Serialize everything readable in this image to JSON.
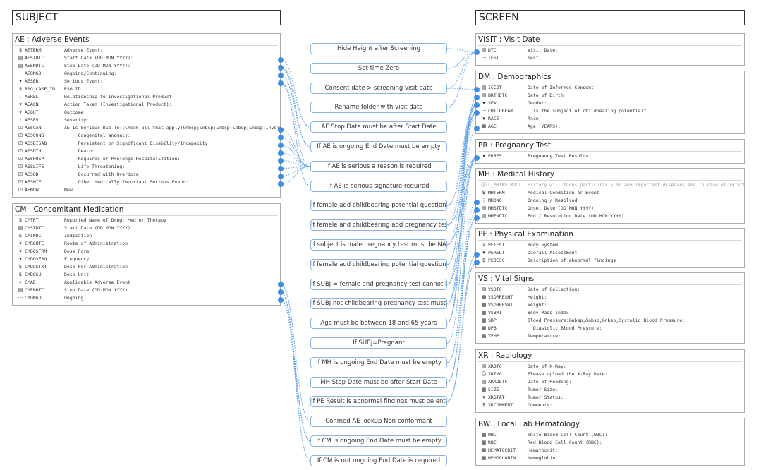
{
  "headers": {
    "subject": "SUBJECT",
    "screen": "SCREEN"
  },
  "colors": {
    "link": "#5a9de8",
    "dot": "#3f8ee6",
    "rule_border": "#8bb4e0"
  },
  "icon_legend": {
    "text": "dollar-sign-icon",
    "date": "calendar-icon",
    "ellipsis": "ellipsis-icon",
    "dropdown": "caret-down-icon",
    "vertical": "vertical-dots-icon",
    "checkbox": "checked-box-icon",
    "search": "search-icon",
    "calc": "calculator-icon",
    "info": "info-icon",
    "user": "user-icon"
  },
  "subject_forms": [
    {
      "title": "AE : Adverse Events",
      "fields": [
        {
          "icon": "text",
          "code": "AETERM",
          "label": "Adverse Event:"
        },
        {
          "icon": "date",
          "code": "AESTDTC",
          "label": "Start Date (DD MON YYYY):"
        },
        {
          "icon": "date",
          "code": "AEENDTC",
          "label": "Stop Date (DD MON YYYY):"
        },
        {
          "icon": "ellipsis",
          "code": "AEONGO",
          "label": "Ongoing/Continuing:"
        },
        {
          "icon": "dropdown",
          "code": "AESER",
          "label": "Serious Event:"
        },
        {
          "icon": "text",
          "code": "RSG_CASE_ID",
          "label": "RSG ID"
        },
        {
          "icon": "vertical",
          "code": "AEREL",
          "label": "Relationship to Investigational Product:"
        },
        {
          "icon": "dropdown",
          "code": "AEACN",
          "label": "Action Taken (Investigational Product):"
        },
        {
          "icon": "dropdown",
          "code": "AEOUT",
          "label": "Outcome:"
        },
        {
          "icon": "vertical",
          "code": "AESEV",
          "label": "Severity:"
        },
        {
          "icon": "checkbox",
          "code": "AESCAN",
          "label": "AE Is Serious Due To:(Check all that apply)&nbsp;&nbsp;&nbsp;&nbsp;&nbsp;Involve"
        },
        {
          "icon": "checkbox",
          "code": "AESCONG",
          "label": "     Congenital anomaly:"
        },
        {
          "icon": "checkbox",
          "code": "AESDISAB",
          "label": "     Persistent or Significant Disability/Incapacity:"
        },
        {
          "icon": "checkbox",
          "code": "AESDTH",
          "label": "     Death:"
        },
        {
          "icon": "checkbox",
          "code": "AESHOSP",
          "label": "     Requires or Prolongs Hospitalization:"
        },
        {
          "icon": "checkbox",
          "code": "AESLIFE",
          "label": "     Life Threatening:"
        },
        {
          "icon": "checkbox",
          "code": "AESOD",
          "label": "     Occurred with Overdose:"
        },
        {
          "icon": "checkbox",
          "code": "AESMIE",
          "label": "     Other Medically Important Serious Event:"
        },
        {
          "icon": "checkbox",
          "code": "AENOW",
          "label": "Now"
        }
      ]
    },
    {
      "title": "CM : Concomitant Medication",
      "fields": [
        {
          "icon": "text",
          "code": "CMTRT",
          "label": "Reported Name of Drug, Med or Therapy"
        },
        {
          "icon": "date",
          "code": "CMSTDTC",
          "label": "Start Date (DD MON YYYY)"
        },
        {
          "icon": "text",
          "code": "CMINDC",
          "label": "Indication"
        },
        {
          "icon": "dropdown",
          "code": "CMROUTE",
          "label": "Route of Administration"
        },
        {
          "icon": "dropdown",
          "code": "CMDOSFRM",
          "label": "Dose Form"
        },
        {
          "icon": "dropdown",
          "code": "CMDOSFRQ",
          "label": "Frequency"
        },
        {
          "icon": "text",
          "code": "CMDOSTXT",
          "label": "Dose Per Administration"
        },
        {
          "icon": "text",
          "code": "CMDOSU",
          "label": "Dose Unit"
        },
        {
          "icon": "search",
          "code": "CMAE",
          "label": "Applicable Adverse Event"
        },
        {
          "icon": "date",
          "code": "CMENDTC",
          "label": "Stop Date (DD MON YYYY)"
        },
        {
          "icon": "ellipsis",
          "code": "CMONGO",
          "label": "Ongoing"
        }
      ]
    }
  ],
  "screen_forms": [
    {
      "title": "VISIT : Visit Date",
      "fields": [
        {
          "icon": "date",
          "code": "DTC",
          "label": "Visit Date:"
        },
        {
          "icon": "ellipsis",
          "code": "TEST",
          "label": "Test"
        }
      ]
    },
    {
      "title": "DM : Demographics",
      "fields": [
        {
          "icon": "date",
          "code": "ICCDT",
          "label": "Date of Informed Consent"
        },
        {
          "icon": "date",
          "code": "BRTHDTC",
          "label": "Date of Birth"
        },
        {
          "icon": "dropdown",
          "code": "SEX",
          "label": "Gender:"
        },
        {
          "icon": "ellipsis",
          "code": "CHILDBEAR",
          "label": "  Is the subject of childbearing potential?"
        },
        {
          "icon": "dropdown",
          "code": "RACE",
          "label": "Race:"
        },
        {
          "icon": "calc",
          "code": "AGE",
          "label": "Age (YEARS):"
        }
      ]
    },
    {
      "title": "PR : Pregnancy Test",
      "fields": [
        {
          "icon": "dropdown",
          "code": "PRRES",
          "label": "Pregnancy Test Results:"
        }
      ]
    },
    {
      "title": "MH : Medical History",
      "fields": [
        {
          "icon": "info",
          "code": "L_MHINSTRUCT",
          "label": "History will focus particularly on any important diseases and in case of infecti",
          "grey": true
        },
        {
          "icon": "text",
          "code": "MHTERM",
          "label": "Medical Condition or Event"
        },
        {
          "icon": "vertical",
          "code": "MHONG",
          "label": "Ongoing / Resolved"
        },
        {
          "icon": "date",
          "code": "MHSTDTC",
          "label": "Onset Date (DD MON YYYY)"
        },
        {
          "icon": "date",
          "code": "MHENDTC",
          "label": "End / Resolution Date (DD MON YYYY)"
        }
      ]
    },
    {
      "title": "PE : Physical Examination",
      "fields": [
        {
          "icon": "search",
          "code": "PETEST",
          "label": "Body System"
        },
        {
          "icon": "dropdown",
          "code": "PERSLT",
          "label": "Overall Assessment"
        },
        {
          "icon": "text",
          "code": "PEDESC",
          "label": "Description of abnormal findings"
        }
      ]
    },
    {
      "title": "VS : Vital Signs",
      "fields": [
        {
          "icon": "date",
          "code": "VSDTC",
          "label": "Date of Collection:"
        },
        {
          "icon": "calc",
          "code": "VSORRESHT",
          "label": "Height:"
        },
        {
          "icon": "calc",
          "code": "VSORRESWT",
          "label": "Weight:"
        },
        {
          "icon": "calc",
          "code": "VSBMI",
          "label": "Body Mass Index"
        },
        {
          "icon": "calc",
          "code": "SBP",
          "label": "Blood Pressure:&nbsp;&nbsp;&nbsp;Systolic Blood Pressure:"
        },
        {
          "icon": "calc",
          "code": "DPB",
          "label": "  Diastolic Blood Pressure:"
        },
        {
          "icon": "calc",
          "code": "TEMP",
          "label": "Temperature:"
        }
      ]
    },
    {
      "title": "XR : Radiology",
      "fields": [
        {
          "icon": "date",
          "code": "XRDTC",
          "label": "Date of X-Ray:"
        },
        {
          "icon": "user",
          "code": "XRIMG",
          "label": "Please upload the X-Ray here:"
        },
        {
          "icon": "date",
          "code": "XRRDDTC",
          "label": "Date of Reading:"
        },
        {
          "icon": "calc",
          "code": "SIZE",
          "label": "Tumor Size:"
        },
        {
          "icon": "dropdown",
          "code": "XRSTAT",
          "label": "Tumor Status:"
        },
        {
          "icon": "text",
          "code": "XRCOMMENT",
          "label": "Comments:"
        }
      ]
    },
    {
      "title": "BW : Local Lab Hematology",
      "fields": [
        {
          "icon": "calc",
          "code": "WBC",
          "label": "White Blood Cell Count (WBC):"
        },
        {
          "icon": "calc",
          "code": "RBC",
          "label": "Red Blood Cell Count (RBC):"
        },
        {
          "icon": "calc",
          "code": "HEMATOCRIT",
          "label": "Hematocrit:"
        },
        {
          "icon": "calc",
          "code": "HEMOGLOBIN",
          "label": "Hemoglobin:"
        }
      ]
    }
  ],
  "rules": [
    "Hide Height after Screening",
    "Set time Zero",
    "Consent date > screening visit date",
    "Rename folder with visit date",
    "AE Stop Date must be after Start Date",
    "If AE is ongoing End Date must be empty",
    "If AE is serious a reason is required",
    "If AE is serious signature required",
    "If female add childbearing potential question (2)",
    "If female and childbearing add pregnancy test",
    "If subject is male pregnancy test must be NA",
    "If female add childbearing potential question (1)",
    "If SUBJ = female and pregnancy test cannot be NA",
    "If SUBJ not childbearing pregnancy test must be ...",
    "Age must be between 18 and 65 years",
    "If SUBJ=Pregnant",
    "If MH is ongoing End Date must be empty",
    "MH Stop Date must be after Start Date",
    "If PE Result is abnormal findings must be entered",
    "Conmed AE lookup Non conformant",
    "If CM is ongoing End Date must be empty",
    "If CM is not ongoing End Date is required"
  ],
  "connections": [
    {
      "rule": 0,
      "left": [],
      "right": [
        [
          "VISIT",
          "DTC"
        ]
      ]
    },
    {
      "rule": 1,
      "left": [],
      "right": [
        [
          "VISIT",
          "DTC"
        ]
      ]
    },
    {
      "rule": 2,
      "left": [],
      "right": [
        [
          "VISIT",
          "DTC"
        ],
        [
          "DM",
          "ICCDT"
        ]
      ]
    },
    {
      "rule": 3,
      "left": [],
      "right": [
        [
          "VISIT",
          "DTC"
        ]
      ]
    },
    {
      "rule": 4,
      "left": [
        [
          "AE",
          "AESTDTC"
        ],
        [
          "AE",
          "AEENDTC"
        ]
      ],
      "right": []
    },
    {
      "rule": 5,
      "left": [
        [
          "AE",
          "AEENDTC"
        ],
        [
          "AE",
          "AEONGO"
        ]
      ],
      "right": []
    },
    {
      "rule": 6,
      "left": [
        [
          "AE",
          "AESER"
        ],
        [
          "AE",
          "AESCAN"
        ],
        [
          "AE",
          "AESCONG"
        ],
        [
          "AE",
          "AESDISAB"
        ],
        [
          "AE",
          "AESDTH"
        ],
        [
          "AE",
          "AESHOSP"
        ],
        [
          "AE",
          "AESLIFE"
        ],
        [
          "AE",
          "AESOD"
        ],
        [
          "AE",
          "AESMIE"
        ]
      ],
      "right": []
    },
    {
      "rule": 7,
      "left": [
        [
          "AE",
          "AESER"
        ]
      ],
      "right": []
    },
    {
      "rule": 8,
      "left": [],
      "right": [
        [
          "DM",
          "SEX"
        ],
        [
          "DM",
          "CHILDBEAR"
        ]
      ]
    },
    {
      "rule": 9,
      "left": [],
      "right": [
        [
          "DM",
          "SEX"
        ],
        [
          "DM",
          "CHILDBEAR"
        ],
        [
          "PR",
          "PRRES"
        ]
      ]
    },
    {
      "rule": 10,
      "left": [],
      "right": [
        [
          "DM",
          "SEX"
        ],
        [
          "PR",
          "PRRES"
        ]
      ]
    },
    {
      "rule": 11,
      "left": [],
      "right": [
        [
          "DM",
          "SEX"
        ],
        [
          "DM",
          "CHILDBEAR"
        ]
      ]
    },
    {
      "rule": 12,
      "left": [],
      "right": [
        [
          "DM",
          "SEX"
        ],
        [
          "PR",
          "PRRES"
        ]
      ]
    },
    {
      "rule": 13,
      "left": [],
      "right": [
        [
          "DM",
          "CHILDBEAR"
        ],
        [
          "PR",
          "PRRES"
        ]
      ]
    },
    {
      "rule": 14,
      "left": [],
      "right": [
        [
          "DM",
          "AGE"
        ],
        [
          "DM",
          "BRTHDTC"
        ]
      ]
    },
    {
      "rule": 15,
      "left": [],
      "right": [
        [
          "PR",
          "PRRES"
        ]
      ]
    },
    {
      "rule": 16,
      "left": [],
      "right": [
        [
          "MH",
          "MHONG"
        ],
        [
          "MH",
          "MHENDTC"
        ]
      ]
    },
    {
      "rule": 17,
      "left": [],
      "right": [
        [
          "MH",
          "MHSTDTC"
        ],
        [
          "MH",
          "MHENDTC"
        ]
      ]
    },
    {
      "rule": 18,
      "left": [],
      "right": [
        [
          "PE",
          "PERSLT"
        ],
        [
          "PE",
          "PEDESC"
        ]
      ]
    },
    {
      "rule": 19,
      "left": [
        [
          "CM",
          "CMAE"
        ]
      ],
      "right": []
    },
    {
      "rule": 20,
      "left": [
        [
          "CM",
          "CMENDTC"
        ],
        [
          "CM",
          "CMONGO"
        ]
      ],
      "right": []
    },
    {
      "rule": 21,
      "left": [
        [
          "CM",
          "CMENDTC"
        ],
        [
          "CM",
          "CMONGO"
        ]
      ],
      "right": []
    }
  ]
}
